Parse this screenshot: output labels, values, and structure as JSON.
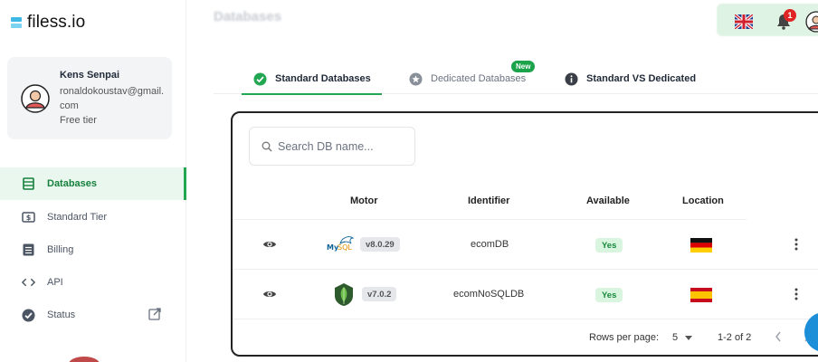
{
  "app": {
    "logo_text": "filess.io",
    "page_title": "Databases"
  },
  "profile": {
    "name": "Kens Senpai",
    "email": "ronaldokoustav@gmail.com",
    "tier": "Free tier"
  },
  "sidebar": {
    "items": [
      {
        "label": "Databases",
        "icon": "database-icon",
        "active": true
      },
      {
        "label": "Standard Tier",
        "icon": "dollar-card-icon",
        "active": false
      },
      {
        "label": "Billing",
        "icon": "billing-icon",
        "active": false
      },
      {
        "label": "API",
        "icon": "code-icon",
        "active": false
      },
      {
        "label": "Status",
        "icon": "check-circle-icon",
        "active": false,
        "external": true
      }
    ]
  },
  "topbar": {
    "language_flag": "uk-flag-icon",
    "notification_count": "1"
  },
  "tabs": [
    {
      "label": "Standard Databases",
      "icon": "check-circle-icon",
      "active": true
    },
    {
      "label": "Dedicated Databases",
      "icon": "star-icon",
      "active": false,
      "badge": "New"
    },
    {
      "label": "Standard VS Dedicated",
      "icon": "info-icon",
      "active": false
    }
  ],
  "search": {
    "placeholder": "Search DB name..."
  },
  "table": {
    "columns": [
      "Motor",
      "Identifier",
      "Available",
      "Location"
    ],
    "rows": [
      {
        "motor": "MySQL",
        "motor_icon": "mysql-icon",
        "version": "v8.0.29",
        "identifier": "ecomDB",
        "available": "Yes",
        "location_flag": "germany-flag-icon"
      },
      {
        "motor": "MongoDB",
        "motor_icon": "mongodb-icon",
        "version": "v7.0.2",
        "identifier": "ecomNoSQLDB",
        "available": "Yes",
        "location_flag": "spain-flag-icon"
      }
    ]
  },
  "pagination": {
    "rows_per_page_label": "Rows per page:",
    "rows_per_page": "5",
    "range": "1-2 of 2"
  },
  "colors": {
    "accent_green": "#22a652",
    "badge_green": "#1aa34a",
    "notification_red": "#e02424",
    "fab_blue": "#1d8fd8"
  }
}
